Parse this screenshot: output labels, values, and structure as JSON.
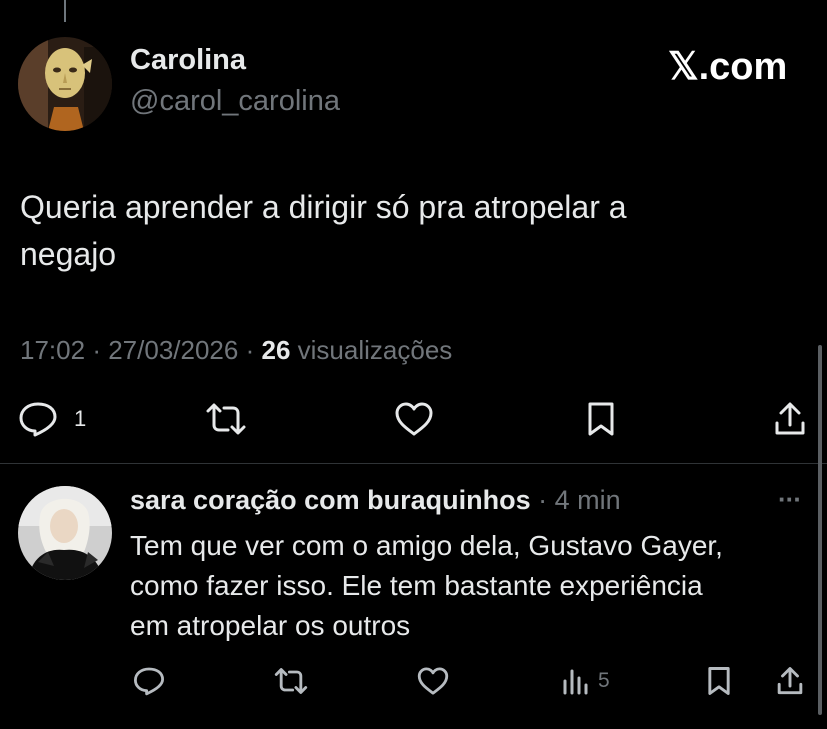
{
  "brand": {
    "logo_text": "𝕏.com"
  },
  "tweet": {
    "author_name": "Carolina",
    "author_handle": "@carol_carolina",
    "text_line1": "Queria aprender a dirigir só pra atropelar a",
    "text_line2": "negajo",
    "time": "17:02",
    "date": "27/03/2026",
    "separator": "·",
    "views_count": "26",
    "views_label": "visualizações",
    "reply_count": "1",
    "icons": [
      "reply-icon",
      "retweet-icon",
      "like-icon",
      "bookmark-icon",
      "share-icon"
    ]
  },
  "reply": {
    "author_name": "sara coração com buraquinhos",
    "separator": "·",
    "time_ago": "4 min",
    "more": "···",
    "text_line1": "Tem que ver com o amigo dela, Gustavo Gayer,",
    "text_line2": "como fazer isso. Ele tem bastante experiência",
    "text_line3": "em atropelar os outros",
    "views_count": "5",
    "icons": [
      "reply-icon",
      "retweet-icon",
      "like-icon",
      "views-icon",
      "bookmark-icon",
      "share-icon"
    ]
  },
  "colors": {
    "background": "#000000",
    "text": "#e7e9ea",
    "muted": "#71767b",
    "divider": "#2f3336"
  }
}
